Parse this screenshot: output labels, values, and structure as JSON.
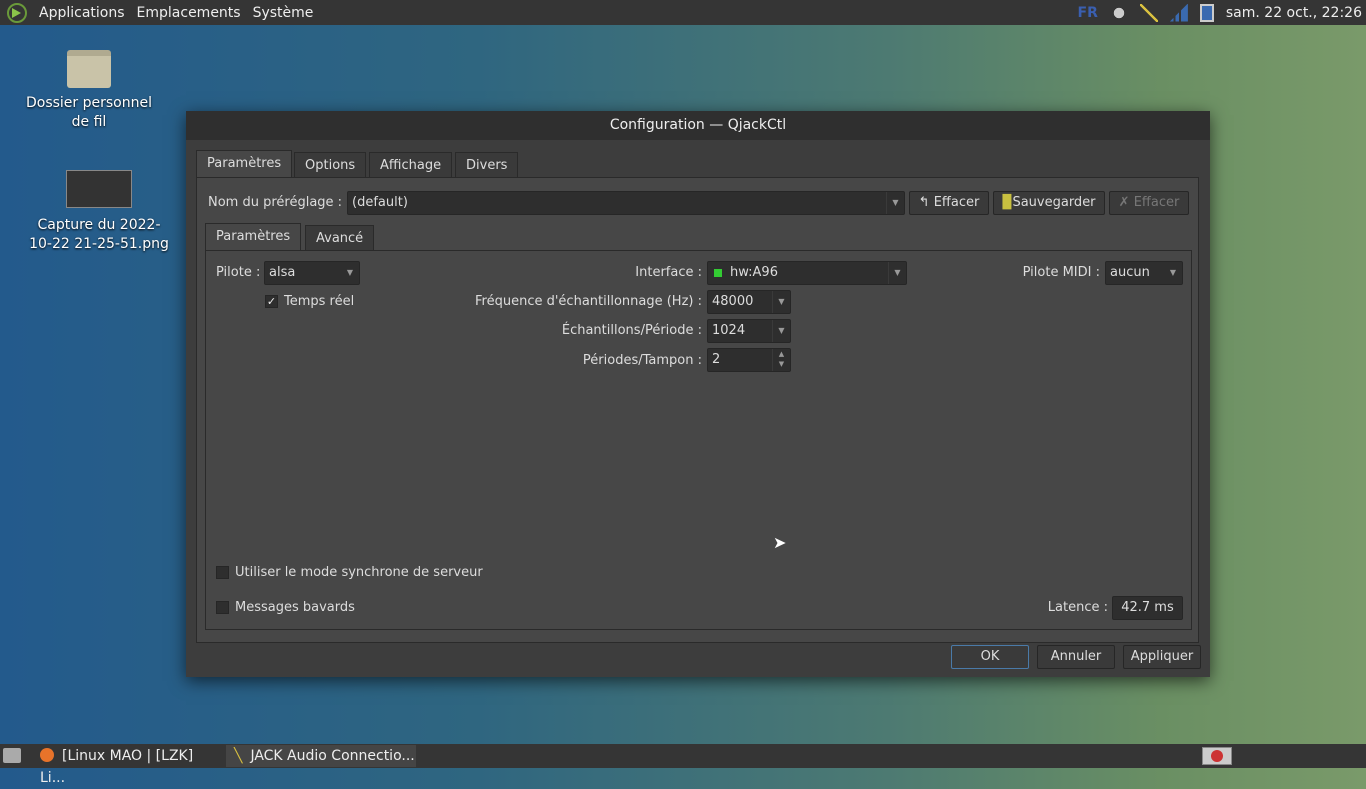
{
  "topbar": {
    "menus": [
      "Applications",
      "Emplacements",
      "Système"
    ],
    "keyboard": "FR",
    "clock": "sam. 22 oct., 22:26"
  },
  "desktop": {
    "icons": [
      {
        "label": "Dossier personnel de fil"
      },
      {
        "label": "Capture du 2022-10-22 21-25-51.png"
      }
    ]
  },
  "dialog": {
    "title": "Configuration — QjackCtl",
    "tabs": [
      "Paramètres",
      "Options",
      "Affichage",
      "Divers"
    ],
    "preset": {
      "label": "Nom du préréglage :",
      "value": "(default)",
      "clear": "Effacer",
      "save": "Sauvegarder",
      "delete": "Effacer"
    },
    "subtabs": [
      "Paramètres",
      "Avancé"
    ],
    "driver": {
      "label": "Pilote :",
      "value": "alsa"
    },
    "realtime": {
      "label": "Temps réel",
      "checked": true
    },
    "interface": {
      "label": "Interface :",
      "value": "hw:A96"
    },
    "midi": {
      "label": "Pilote MIDI :",
      "value": "aucun"
    },
    "rate": {
      "label": "Fréquence d'échantillonnage (Hz) :",
      "value": "48000"
    },
    "frames": {
      "label": "Échantillons/Période :",
      "value": "1024"
    },
    "periods": {
      "label": "Périodes/Tampon :",
      "value": "2"
    },
    "sync": {
      "label": "Utiliser le mode synchrone de serveur",
      "checked": false
    },
    "verbose": {
      "label": "Messages bavards",
      "checked": false
    },
    "latency": {
      "label": "Latence :",
      "value": "42.7 ms"
    },
    "buttons": {
      "ok": "OK",
      "cancel": "Annuler",
      "apply": "Appliquer"
    }
  },
  "taskbar": {
    "tasks": [
      "[Linux MAO | [LZK] Li...",
      "JACK Audio Connectio..."
    ]
  }
}
